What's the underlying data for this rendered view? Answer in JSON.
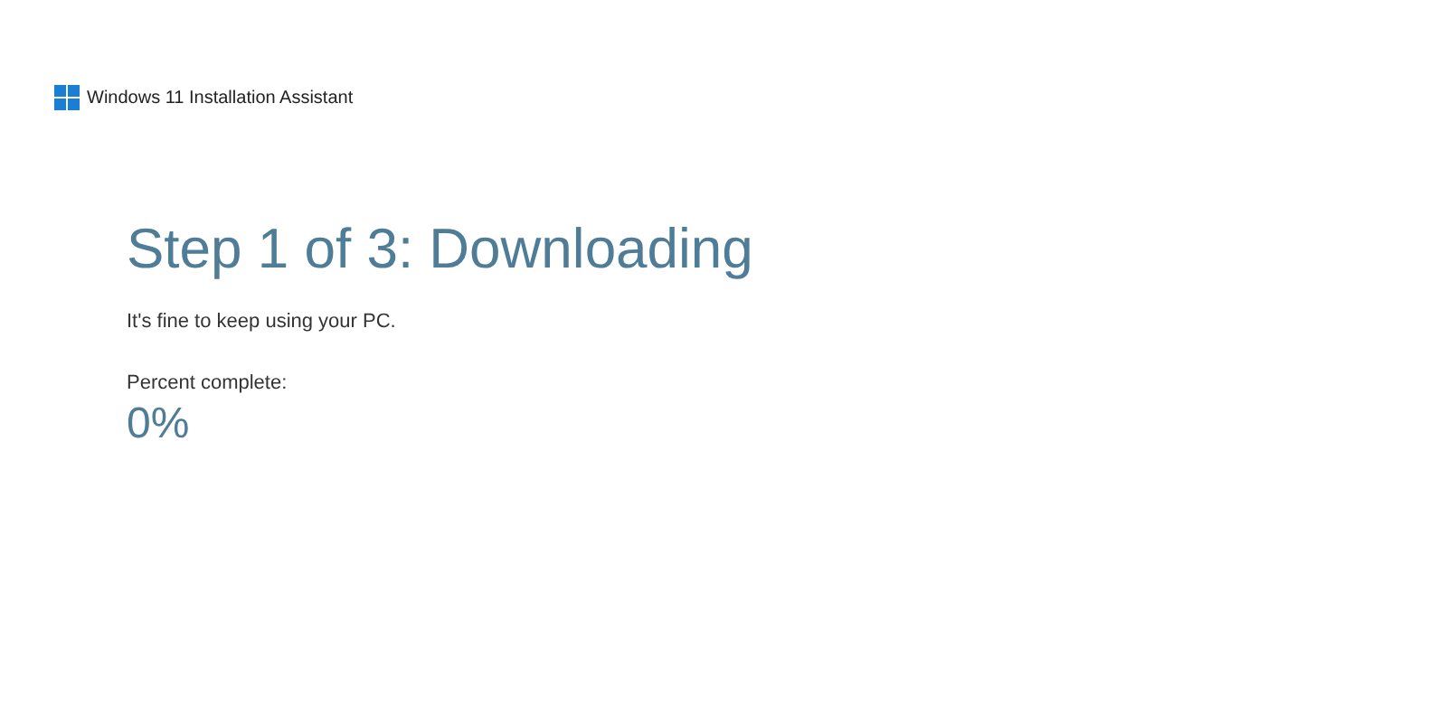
{
  "window": {
    "title": "Windows 11 Installation Assistant"
  },
  "heading": "Step 1 of 3: Downloading",
  "message": "It's fine to keep using your PC.",
  "progress": {
    "label": "Percent complete:",
    "value": "0%"
  }
}
